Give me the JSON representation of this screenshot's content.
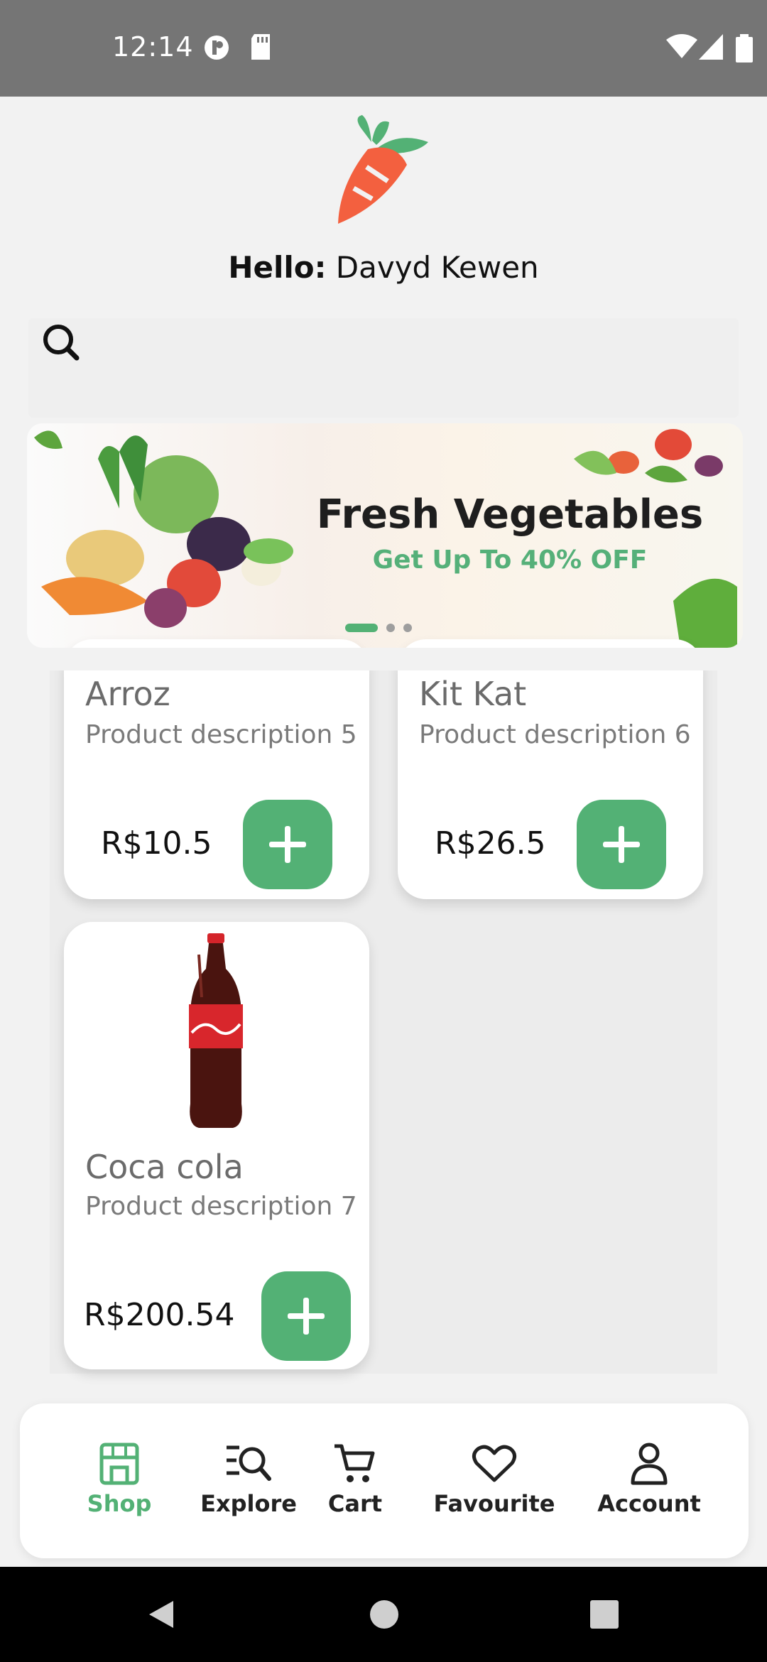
{
  "status_bar": {
    "time": "12:14"
  },
  "header": {
    "greeting_label": "Hello:",
    "user_name": "Davyd Kewen"
  },
  "banner": {
    "title": "Fresh Vegetables",
    "subtitle": "Get Up To 40% OFF",
    "pages": 3,
    "active_page": 1
  },
  "products": [
    {
      "name": "Arroz",
      "description": "Product description 5",
      "price": "R$10.5"
    },
    {
      "name": "Kit Kat",
      "description": "Product description 6",
      "price": "R$26.5"
    },
    {
      "name": "Coca cola",
      "description": "Product description 7",
      "price": "R$200.54"
    }
  ],
  "bottom_nav": {
    "items": [
      {
        "label": "Shop",
        "icon": "store-icon",
        "active": true
      },
      {
        "label": "Explore",
        "icon": "explore-icon",
        "active": false
      },
      {
        "label": "Cart",
        "icon": "cart-icon",
        "active": false
      },
      {
        "label": "Favourite",
        "icon": "heart-icon",
        "active": false
      },
      {
        "label": "Account",
        "icon": "user-icon",
        "active": false
      }
    ]
  },
  "colors": {
    "accent": "#53b175",
    "carrot": "#f3603f",
    "status_bar": "#757575"
  }
}
